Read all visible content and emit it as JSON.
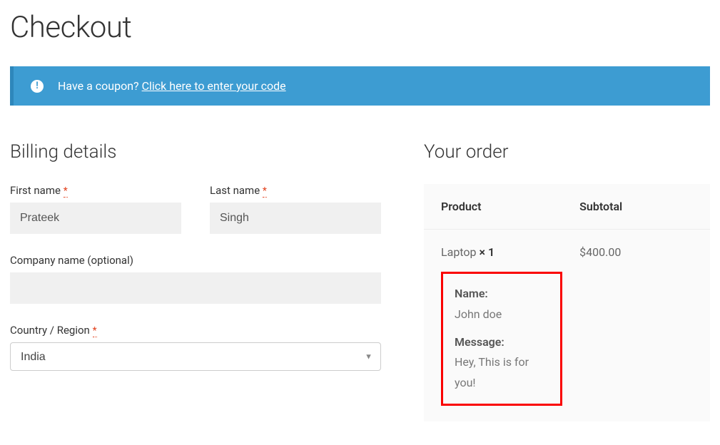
{
  "page": {
    "title": "Checkout"
  },
  "coupon": {
    "prompt": "Have a coupon? ",
    "link_text": "Click here to enter your code"
  },
  "billing": {
    "heading": "Billing details",
    "first_name_label": "First name",
    "first_name_value": "Prateek",
    "last_name_label": "Last name",
    "last_name_value": "Singh",
    "company_label": "Company name (optional)",
    "company_value": "",
    "country_label": "Country / Region",
    "country_value": "India",
    "required_mark": "*"
  },
  "order": {
    "heading": "Your order",
    "col_product": "Product",
    "col_subtotal": "Subtotal",
    "item_name": "Laptop ",
    "item_qty": "× 1",
    "item_subtotal": "$400.00",
    "gift_name_label": "Name:",
    "gift_name_value": "John doe",
    "gift_message_label": "Message:",
    "gift_message_value": "Hey, This is for you!"
  }
}
